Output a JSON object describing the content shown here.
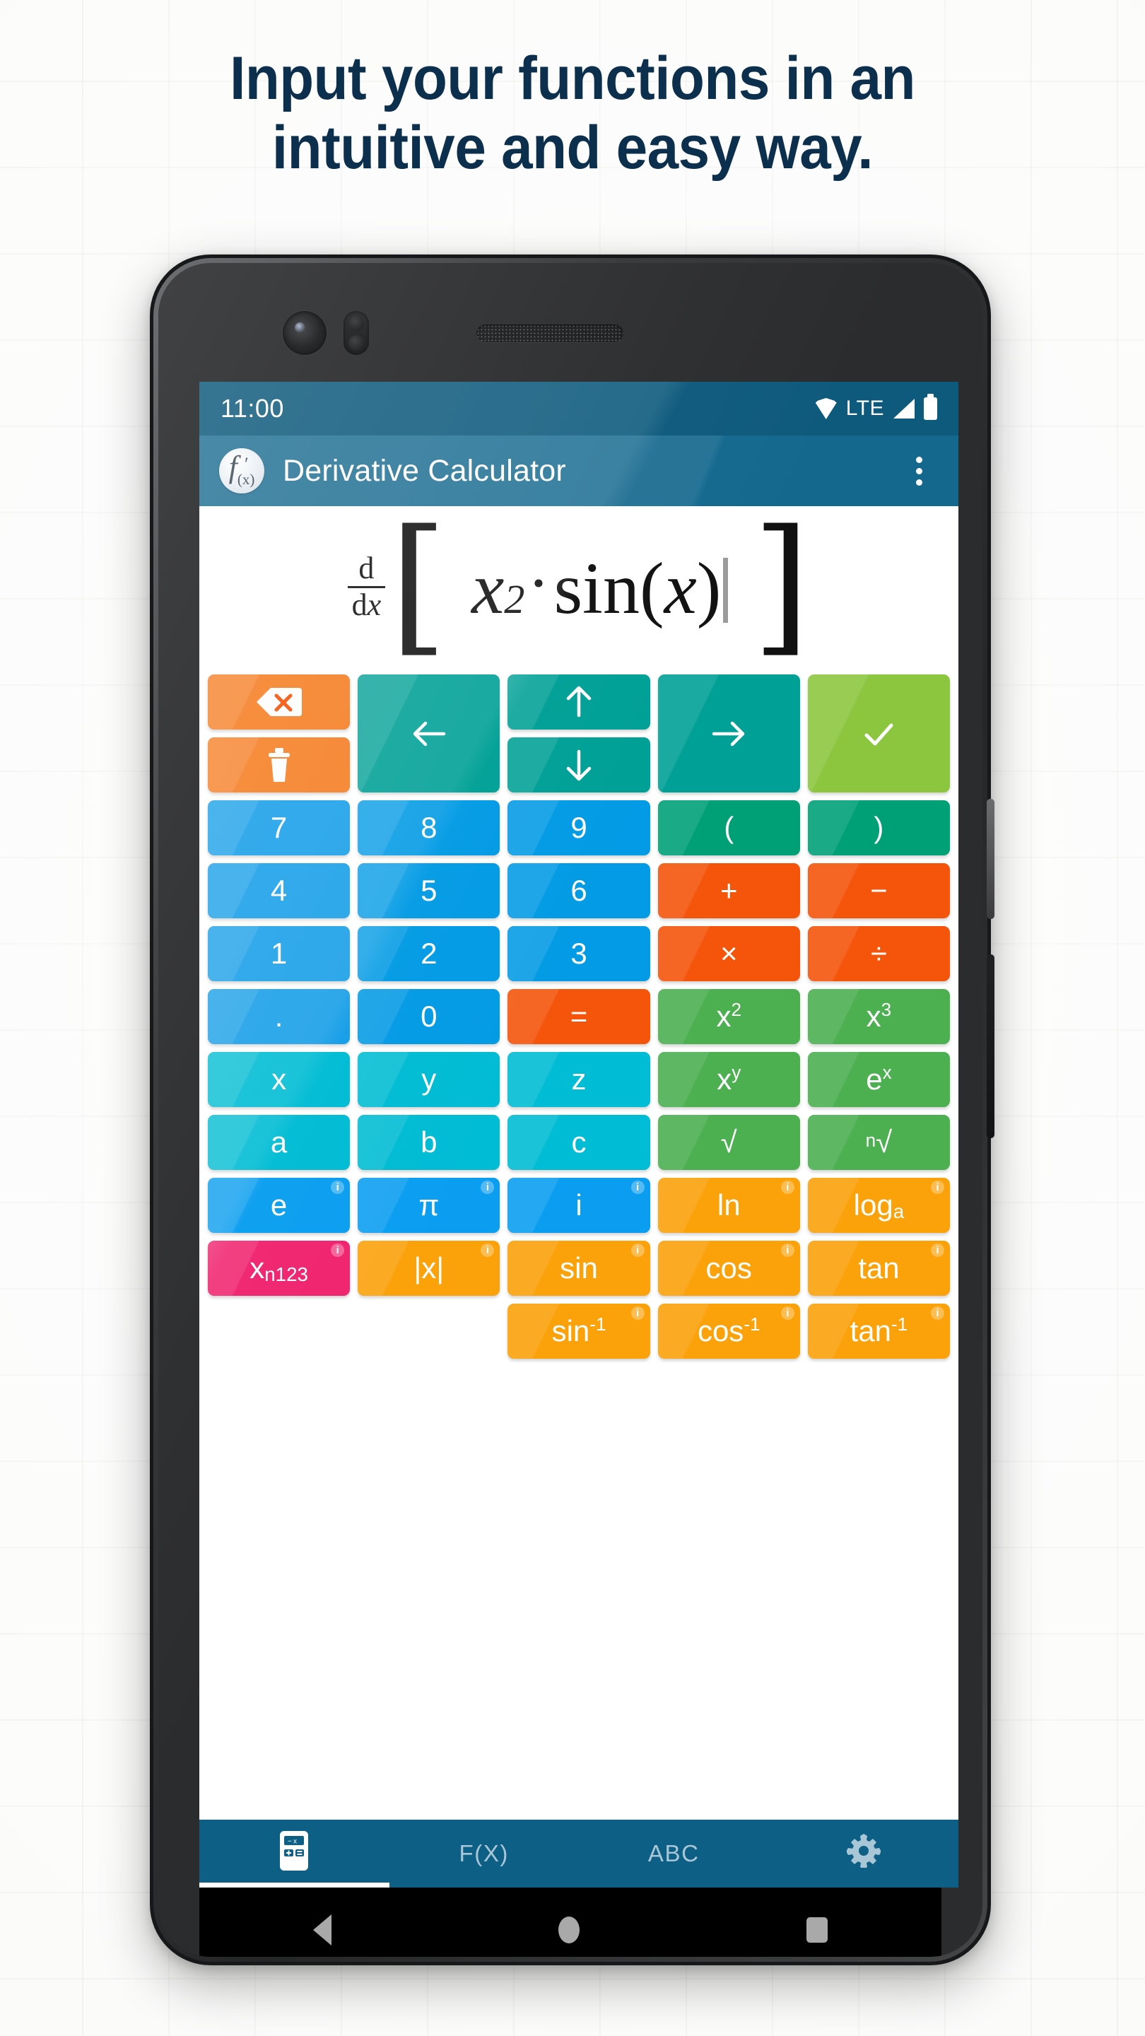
{
  "headline": {
    "line1": "Input your functions in an",
    "line2": "intuitive and easy way.",
    "color": "#0c2f4d"
  },
  "status_bar": {
    "time": "11:00",
    "network": "LTE",
    "icons": [
      "wifi-icon",
      "signal-icon",
      "battery-icon"
    ]
  },
  "app_bar": {
    "logo": "fx-logo-icon",
    "logo_text": "f",
    "logo_sub": "(x)",
    "logo_prime": "′",
    "title": "Derivative Calculator",
    "menu": "overflow-menu-icon"
  },
  "display": {
    "operator_num": "d",
    "operator_den_d": "d",
    "operator_den_x": "x",
    "bracket_left": "[",
    "bracket_right": "]",
    "base": "x",
    "exponent": "2",
    "multiply": "·",
    "function": "sin",
    "paren_open": "(",
    "argument": "x",
    "paren_close": ")",
    "expression_text": "d/dx [ x²·sin(x) ]"
  },
  "colors": {
    "orange": "#f57c20",
    "orange_bright": "#f4550b",
    "teal": "#00a096",
    "teal_dark": "#009688",
    "lime": "#8cc63f",
    "blue": "#0b9ef0",
    "blue_alt": "#039be5",
    "green_paren": "#00a077",
    "green": "#4caf50",
    "cyan": "#00bcd4",
    "amber": "#fba10a",
    "pink": "#f0256f",
    "appbar": "#14688e",
    "statusbar": "#0e5a7d",
    "bottomnav": "#0d5f85"
  },
  "control_row": {
    "backspace": {
      "name": "backspace-key",
      "icon": "backspace-icon",
      "color": "#f57c20"
    },
    "clear": {
      "name": "clear-all-key",
      "icon": "trash-icon",
      "color": "#f57c20"
    },
    "left": {
      "name": "cursor-left-key",
      "icon": "arrow-left-icon",
      "color": "#00a096"
    },
    "up": {
      "name": "cursor-up-key",
      "icon": "arrow-up-icon",
      "color": "#00a096"
    },
    "down": {
      "name": "cursor-down-key",
      "icon": "arrow-down-icon",
      "color": "#00a096"
    },
    "right": {
      "name": "cursor-right-key",
      "icon": "arrow-right-icon",
      "color": "#00a096"
    },
    "submit": {
      "name": "submit-key",
      "icon": "check-icon",
      "color": "#8cc63f"
    }
  },
  "keypad_rows": [
    [
      {
        "label": "7",
        "color": "#169ee8",
        "name": "key-7",
        "info": false
      },
      {
        "label": "8",
        "color": "#039be5",
        "name": "key-8",
        "info": false
      },
      {
        "label": "9",
        "color": "#039be5",
        "name": "key-9",
        "info": false
      },
      {
        "label": "(",
        "color": "#00a077",
        "name": "key-paren-open",
        "info": false
      },
      {
        "label": ")",
        "color": "#00a077",
        "name": "key-paren-close",
        "info": false
      }
    ],
    [
      {
        "label": "4",
        "color": "#169ee8",
        "name": "key-4",
        "info": false
      },
      {
        "label": "5",
        "color": "#039be5",
        "name": "key-5",
        "info": false
      },
      {
        "label": "6",
        "color": "#039be5",
        "name": "key-6",
        "info": false
      },
      {
        "label": "+",
        "color": "#f4550b",
        "name": "key-plus",
        "info": false
      },
      {
        "label": "−",
        "color": "#f4550b",
        "name": "key-minus",
        "info": false
      }
    ],
    [
      {
        "label": "1",
        "color": "#169ee8",
        "name": "key-1",
        "info": false
      },
      {
        "label": "2",
        "color": "#039be5",
        "name": "key-2",
        "info": false
      },
      {
        "label": "3",
        "color": "#039be5",
        "name": "key-3",
        "info": false
      },
      {
        "label": "×",
        "color": "#f4550b",
        "name": "key-multiply",
        "info": false
      },
      {
        "label": "÷",
        "color": "#f4550b",
        "name": "key-divide",
        "info": false
      }
    ],
    [
      {
        "label": ".",
        "color": "#169ee8",
        "name": "key-decimal-point",
        "info": false
      },
      {
        "label": "0",
        "color": "#039be5",
        "name": "key-0",
        "info": false
      },
      {
        "label": "=",
        "color": "#f4550b",
        "name": "key-equals",
        "info": false
      },
      {
        "label": "x",
        "sup": "2",
        "color": "#4caf50",
        "name": "key-x-squared",
        "info": false
      },
      {
        "label": "x",
        "sup": "3",
        "color": "#4caf50",
        "name": "key-x-cubed",
        "info": false
      }
    ],
    [
      {
        "label": "x",
        "color": "#00bcd4",
        "name": "key-var-x",
        "info": false
      },
      {
        "label": "y",
        "color": "#00bcd4",
        "name": "key-var-y",
        "info": false
      },
      {
        "label": "z",
        "color": "#00bcd4",
        "name": "key-var-z",
        "info": false
      },
      {
        "label": "x",
        "sup": "y",
        "color": "#4caf50",
        "name": "key-x-power-y",
        "info": false
      },
      {
        "label": "e",
        "sup": "x",
        "color": "#4caf50",
        "name": "key-e-power-x",
        "info": false
      }
    ],
    [
      {
        "label": "a",
        "color": "#00bcd4",
        "name": "key-var-a",
        "info": false
      },
      {
        "label": "b",
        "color": "#00bcd4",
        "name": "key-var-b",
        "info": false
      },
      {
        "label": "c",
        "color": "#00bcd4",
        "name": "key-var-c",
        "info": false
      },
      {
        "label": "√",
        "color": "#4caf50",
        "name": "key-square-root",
        "info": false
      },
      {
        "pre": "n",
        "label": "√",
        "color": "#4caf50",
        "name": "key-nth-root",
        "info": false
      }
    ],
    [
      {
        "label": "e",
        "color": "#0b9ef0",
        "name": "key-const-e",
        "info": true
      },
      {
        "label": "π",
        "color": "#0b9ef0",
        "name": "key-const-pi",
        "info": true
      },
      {
        "label": "i",
        "color": "#0b9ef0",
        "name": "key-const-i",
        "info": true
      },
      {
        "label": "ln",
        "color": "#fba10a",
        "name": "key-ln",
        "info": true
      },
      {
        "label": "log",
        "sub": "a",
        "color": "#fba10a",
        "name": "key-log-base-a",
        "info": true
      }
    ],
    [
      {
        "label": "x",
        "sub": "n123",
        "color": "#f0256f",
        "name": "key-subscript-variable",
        "info": true
      },
      {
        "label": "|x|",
        "color": "#fba10a",
        "name": "key-absolute-value",
        "info": true
      },
      {
        "label": "sin",
        "color": "#fba10a",
        "name": "key-sin",
        "info": true
      },
      {
        "label": "cos",
        "color": "#fba10a",
        "name": "key-cos",
        "info": true
      },
      {
        "label": "tan",
        "color": "#fba10a",
        "name": "key-tan",
        "info": true
      }
    ],
    [
      {
        "blank": true,
        "name": "key-blank-1"
      },
      {
        "blank": true,
        "name": "key-blank-2"
      },
      {
        "label": "sin",
        "sup": "-1",
        "color": "#fba10a",
        "name": "key-arcsin",
        "info": true
      },
      {
        "label": "cos",
        "sup": "-1",
        "color": "#fba10a",
        "name": "key-arccos",
        "info": true
      },
      {
        "label": "tan",
        "sup": "-1",
        "color": "#fba10a",
        "name": "key-arctan",
        "info": true
      }
    ]
  ],
  "info_badge_label": "i",
  "bottom_nav": [
    {
      "label": "",
      "icon": "calculator-icon",
      "name": "nav-calculator",
      "active": true
    },
    {
      "label": "F(X)",
      "icon": "",
      "name": "nav-functions",
      "active": false
    },
    {
      "label": "ABC",
      "icon": "",
      "name": "nav-abc",
      "active": false
    },
    {
      "label": "",
      "icon": "gear-icon",
      "name": "nav-settings",
      "active": false
    }
  ],
  "android_nav": {
    "back": "back-icon",
    "home": "home-icon",
    "recent": "recent-apps-icon"
  }
}
